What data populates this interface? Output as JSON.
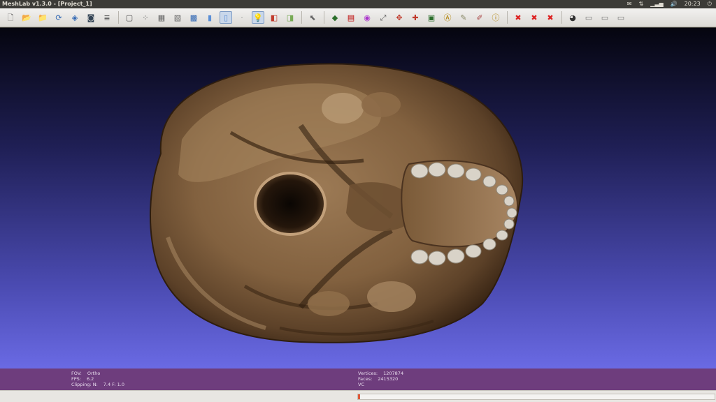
{
  "window": {
    "title": "MeshLab v1.3.0 - [Project_1]"
  },
  "tray": {
    "time": "20:23"
  },
  "toolbar": {
    "groups": [
      [
        {
          "name": "new-file-icon",
          "glyph": "🗋",
          "color": "#555"
        },
        {
          "name": "open-folder-icon",
          "glyph": "📂",
          "color": "#c9a227"
        },
        {
          "name": "import-mesh-icon",
          "glyph": "📁",
          "color": "#c9a227"
        },
        {
          "name": "reload-icon",
          "glyph": "⟳",
          "color": "#2f66b3"
        },
        {
          "name": "save-icon",
          "glyph": "◈",
          "color": "#2f66b3"
        },
        {
          "name": "snapshot-icon",
          "glyph": "◙",
          "color": "#345"
        },
        {
          "name": "layers-icon",
          "glyph": "≣",
          "color": "#555"
        }
      ],
      [
        {
          "name": "bounding-box-icon",
          "glyph": "▢",
          "color": "#555"
        },
        {
          "name": "points-icon",
          "glyph": "⁘",
          "color": "#555"
        },
        {
          "name": "wireframe-icon",
          "glyph": "▦",
          "color": "#666"
        },
        {
          "name": "hidden-lines-icon",
          "glyph": "▧",
          "color": "#666"
        },
        {
          "name": "flat-shading-icon",
          "glyph": "▩",
          "color": "#2f66b3"
        },
        {
          "name": "smooth-shading-icon",
          "glyph": "▮",
          "color": "#5b8fd6"
        },
        {
          "name": "texture-icon",
          "glyph": "▯",
          "color": "#5b8fd6",
          "active": true
        },
        {
          "name": "lighting-off-icon",
          "glyph": "·",
          "color": "#999"
        },
        {
          "name": "light-bulb-icon",
          "glyph": "💡",
          "color": "#d4b000",
          "active": true
        },
        {
          "name": "double-side-icon",
          "glyph": "◧",
          "color": "#c0392b"
        },
        {
          "name": "back-face-icon",
          "glyph": "◨",
          "color": "#7a5"
        }
      ],
      [
        {
          "name": "select-icon",
          "glyph": "⬉",
          "color": "#666"
        }
      ],
      [
        {
          "name": "paint-mesh-icon",
          "glyph": "◆",
          "color": "#2a6e2a"
        },
        {
          "name": "quality-map-icon",
          "glyph": "▤",
          "color": "#b00"
        },
        {
          "name": "color-tool-icon",
          "glyph": "◉",
          "color": "#a3c"
        },
        {
          "name": "measure-icon",
          "glyph": "⤢",
          "color": "#555"
        },
        {
          "name": "align-icon",
          "glyph": "✥",
          "color": "#c0392b"
        },
        {
          "name": "pick-points-icon",
          "glyph": "✚",
          "color": "#c0392b"
        },
        {
          "name": "raster-icon",
          "glyph": "▣",
          "color": "#2a6e2a"
        },
        {
          "name": "annotate-icon",
          "glyph": "Ⓐ",
          "color": "#b08000"
        },
        {
          "name": "edit-geometry-icon",
          "glyph": "✎",
          "color": "#886"
        },
        {
          "name": "brush-icon",
          "glyph": "✐",
          "color": "#a44"
        },
        {
          "name": "info-icon",
          "glyph": "ⓘ",
          "color": "#b08000"
        }
      ],
      [
        {
          "name": "delete-vertices-icon",
          "glyph": "✖",
          "color": "#d22"
        },
        {
          "name": "delete-faces-icon",
          "glyph": "✖",
          "color": "#d22"
        },
        {
          "name": "delete-selection-icon",
          "glyph": "✖",
          "color": "#d22"
        }
      ],
      [
        {
          "name": "camera-icon",
          "glyph": "◕",
          "color": "#333"
        },
        {
          "name": "view-a-icon",
          "glyph": "▭",
          "color": "#777"
        },
        {
          "name": "view-b-icon",
          "glyph": "▭",
          "color": "#777"
        },
        {
          "name": "view-c-icon",
          "glyph": "▭",
          "color": "#777"
        }
      ]
    ]
  },
  "info": {
    "left": [
      {
        "label": "FOV:",
        "value": "Ortho"
      },
      {
        "label": "FPS:",
        "value": "6.2"
      },
      {
        "label": "Clipping: N:",
        "value": "7.4  F:    1.0"
      }
    ],
    "right": [
      {
        "label": "Vertices:",
        "value": "1207874"
      },
      {
        "label": "Faces:",
        "value": "2415320"
      },
      {
        "label": "VC",
        "value": ""
      }
    ]
  },
  "status": {
    "progress": 0.005
  },
  "colors": {
    "info_panel": "#6e3d7d",
    "viewport_bottom": "#6a6ae4",
    "progress_fill": "#e0593a"
  }
}
